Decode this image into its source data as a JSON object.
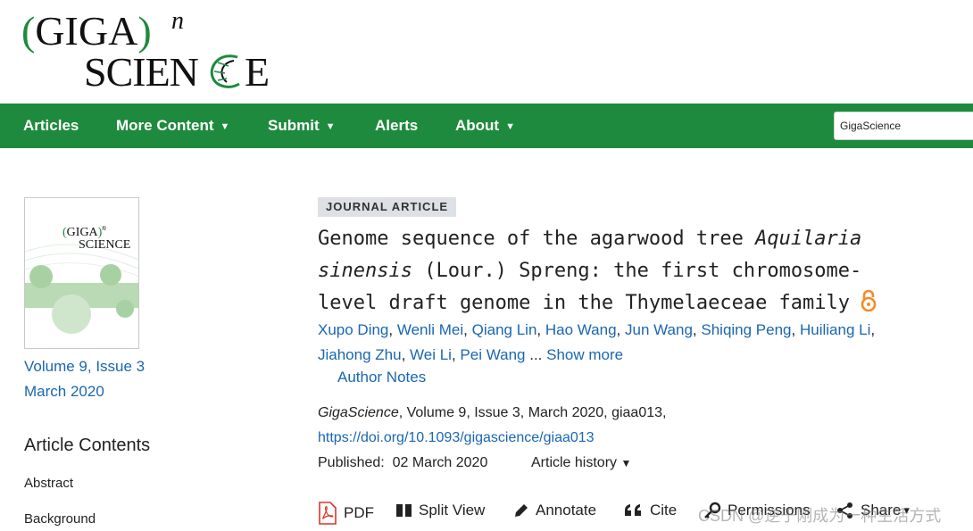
{
  "logo": {
    "top_text": "(GIGA)",
    "superscript": "n",
    "bottom_text": "SCIENCE"
  },
  "nav": {
    "items": [
      {
        "label": "Articles",
        "has_caret": false
      },
      {
        "label": "More Content",
        "has_caret": true
      },
      {
        "label": "Submit",
        "has_caret": true
      },
      {
        "label": "Alerts",
        "has_caret": false
      },
      {
        "label": "About",
        "has_caret": true
      }
    ],
    "caret": "▼",
    "search_value": "GigaScience",
    "bar_color": "#1e8a3d"
  },
  "sidebar": {
    "cover_logo_top": "(GIGA)",
    "cover_logo_sup": "n",
    "cover_logo_bottom": "SCIENCE",
    "volume": "Volume 9, Issue 3",
    "date": "March 2020",
    "contents_title": "Article Contents",
    "contents_items": [
      "Abstract",
      "Background"
    ]
  },
  "article": {
    "badge": "JOURNAL ARTICLE",
    "title_part1": "Genome sequence of the agarwood tree ",
    "title_italic": "Aquilaria sinensis",
    "title_part2": " (Lour.) Spreng: the first chromosome-level draft genome in the Thymelaeceae family",
    "authors": [
      "Xupo Ding",
      "Wenli Mei",
      "Qiang Lin",
      "Hao Wang",
      "Jun Wang",
      "Shiqing Peng",
      "Huiliang Li",
      "Jiahong Zhu",
      "Wei Li",
      "Pei Wang"
    ],
    "ellipsis": " ... ",
    "show_more": "Show more",
    "author_notes": "Author Notes",
    "journal": "GigaScience",
    "citation_rest": ", Volume 9, Issue 3, March 2020, giaa013,",
    "doi": "https://doi.org/10.1093/gigascience/giaa013",
    "published_label": "Published:",
    "published_date": "02 March 2020",
    "history": "Article history",
    "history_caret": "▼",
    "link_color": "#1a66b3",
    "oa_color": "#f28c28"
  },
  "toolbar": {
    "pdf": "PDF",
    "split": "Split View",
    "annotate": "Annotate",
    "cite": "Cite",
    "permissions": "Permissions",
    "share": "Share",
    "share_caret": "▾"
  },
  "watermark": "CSDN @逆于刚成为一种生活方式"
}
